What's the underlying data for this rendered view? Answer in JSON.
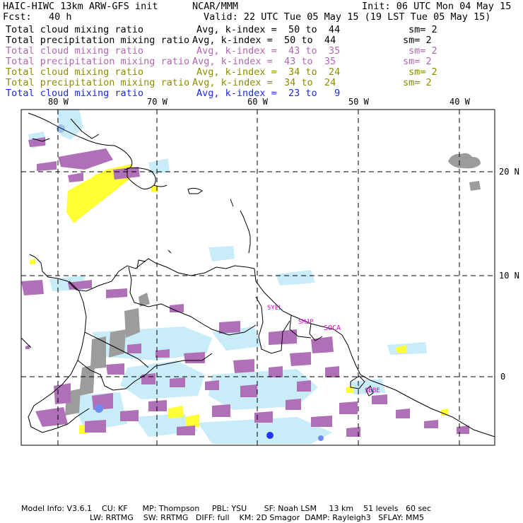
{
  "header": {
    "title_left": "HAIC-HIWC 13km ARW-GFS init",
    "title_center": "NCAR/MMM",
    "init": "Init: 06 UTC Mon 04 May 15",
    "fcst": "Fcst:   40 h",
    "valid": "Valid: 22 UTC Tue 05 May 15 (19 LST Tue 05 May 15)"
  },
  "legend": [
    {
      "name": "Total cloud mixing ratio",
      "avg": "Avg, k-index =  50 to  44",
      "sm": "sm= 2",
      "color": "#000000"
    },
    {
      "name": "Total precipitation mixing ratio",
      "avg": "Avg, k-index =  50 to  44",
      "sm": "sm= 2",
      "color": "#000000"
    },
    {
      "name": "Total cloud mixing ratio",
      "avg": "Avg, k-index =  43 to  35",
      "sm": "sm= 2",
      "color": "#b066b0"
    },
    {
      "name": "Total precipitation mixing ratio",
      "avg": "Avg, k-index =  43 to  35",
      "sm": "sm= 2",
      "color": "#b066b0"
    },
    {
      "name": "Total cloud mixing ratio",
      "avg": "Avg, k-index =  34 to  24",
      "sm": "sm= 2",
      "color": "#8c8c00"
    },
    {
      "name": "Total precipitation mixing ratio",
      "avg": "Avg, k-index =  34 to  24",
      "sm": "sm= 2",
      "color": "#8c8c00"
    },
    {
      "name": "Total cloud mixing ratio",
      "avg": "Avg, k-index =  23 to   9",
      "sm": "",
      "color": "#1e28e6"
    }
  ],
  "map": {
    "lon_labels": [
      "80 W",
      "70 W",
      "60 W",
      "50 W",
      "40 W"
    ],
    "lat_labels": [
      "20 N",
      "10 N",
      "0"
    ],
    "stations": [
      "SYEL",
      "SMJP",
      "SOCA",
      "SBBE"
    ],
    "station_color": "#d000d0",
    "colors": {
      "purple": "#b070b8",
      "yellow": "#ffff33",
      "lightblue": "#c8ecf8",
      "gray": "#999999",
      "blue": "#3355ee"
    }
  },
  "footer": {
    "line1": "Model Info: V3.6.1    CU: KF      MP: Thompson     PBL: YSU       SF: Noah LSM     13 km    51 levels   60 sec",
    "line2": "LW: RRTMG    SW: RRTMG   DIFF: full    KM: 2D Smagor  DAMP: Rayleigh3   SFLAY: MM5"
  }
}
